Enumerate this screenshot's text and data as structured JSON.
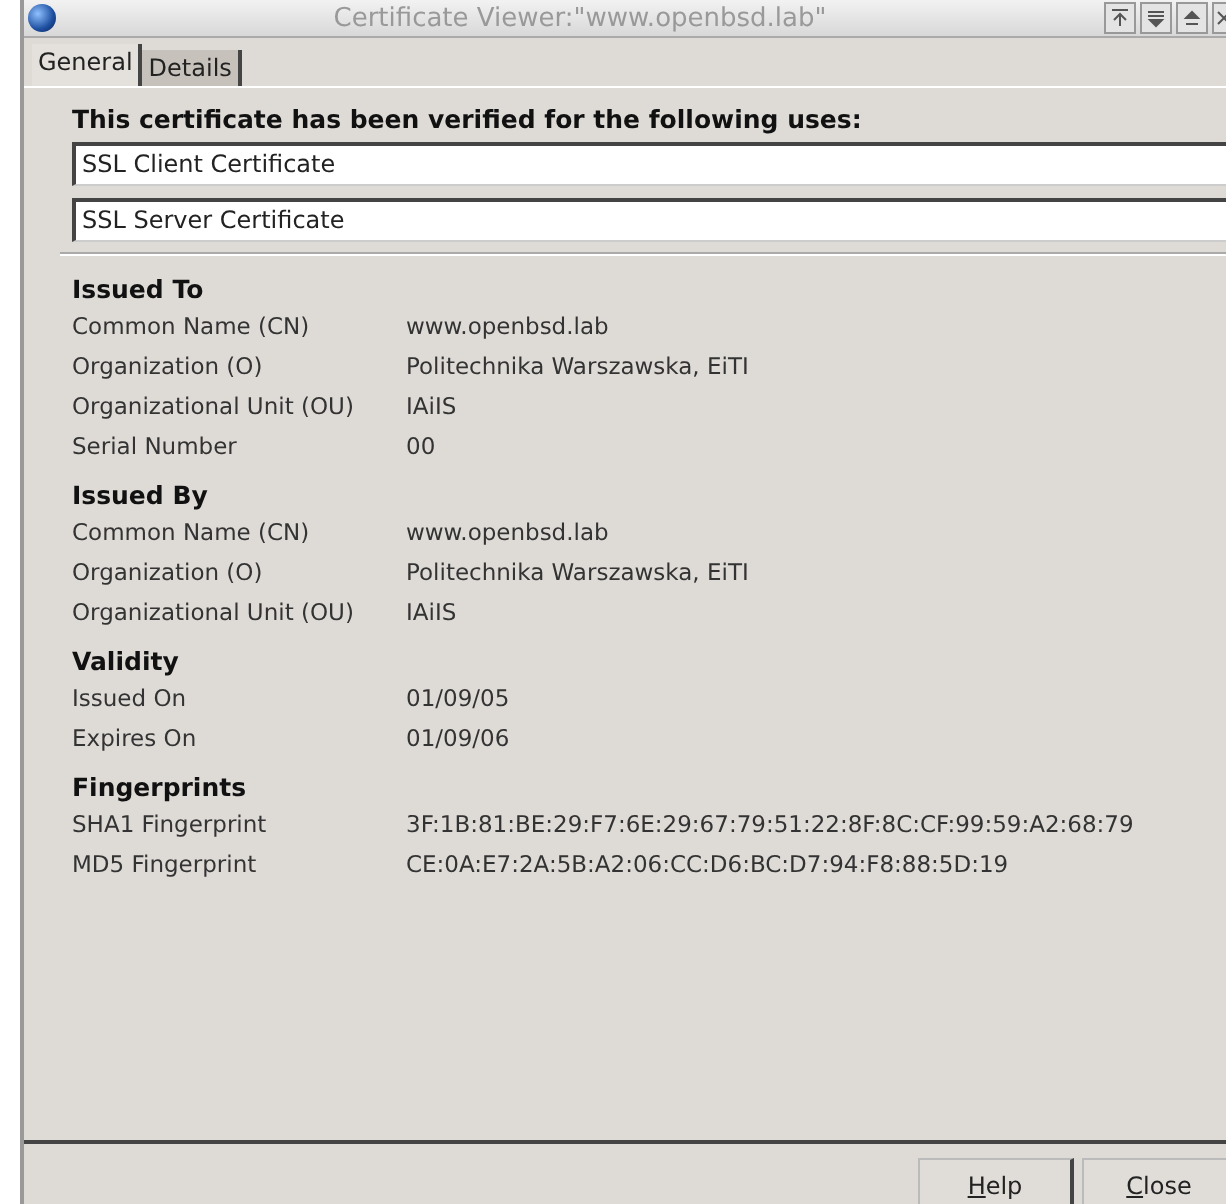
{
  "window": {
    "title": "Certificate Viewer:\"www.openbsd.lab\""
  },
  "tabs": [
    {
      "label": "General",
      "selected": true
    },
    {
      "label": "Details",
      "selected": false
    }
  ],
  "verified": {
    "heading": "This certificate has been verified for the following uses:",
    "uses": [
      "SSL Client Certificate",
      "SSL Server Certificate"
    ]
  },
  "sections": [
    {
      "title": "Issued To",
      "rows": [
        {
          "label": "Common Name (CN)",
          "value": "www.openbsd.lab"
        },
        {
          "label": "Organization (O)",
          "value": "Politechnika Warszawska, EiTI"
        },
        {
          "label": "Organizational Unit (OU)",
          "value": "IAiIS"
        },
        {
          "label": "Serial Number",
          "value": "00"
        }
      ]
    },
    {
      "title": "Issued By",
      "rows": [
        {
          "label": "Common Name (CN)",
          "value": "www.openbsd.lab"
        },
        {
          "label": "Organization (O)",
          "value": "Politechnika Warszawska, EiTI"
        },
        {
          "label": "Organizational Unit (OU)",
          "value": "IAiIS"
        }
      ]
    },
    {
      "title": "Validity",
      "rows": [
        {
          "label": "Issued On",
          "value": "01/09/05"
        },
        {
          "label": "Expires On",
          "value": "01/09/06"
        }
      ]
    },
    {
      "title": "Fingerprints",
      "rows": [
        {
          "label": "SHA1 Fingerprint",
          "value": "3F:1B:81:BE:29:F7:6E:29:67:79:51:22:8F:8C:CF:99:59:A2:68:79"
        },
        {
          "label": "MD5 Fingerprint",
          "value": "CE:0A:E7:2A:5B:A2:06:CC:D6:BC:D7:94:F8:88:5D:19"
        }
      ]
    }
  ],
  "buttons": [
    {
      "label": "Help",
      "first_letter_underlined": true
    },
    {
      "label": "Close",
      "first_letter_underlined": true
    }
  ]
}
